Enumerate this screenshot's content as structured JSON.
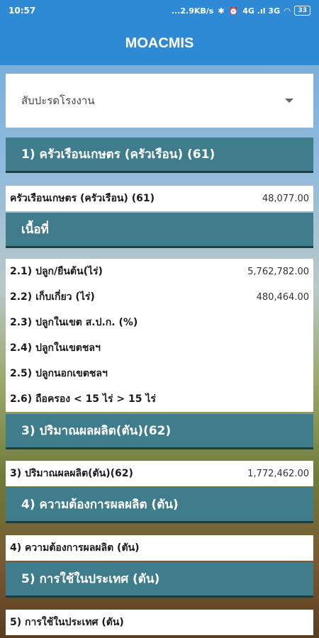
{
  "status": {
    "time": "10:57",
    "speed": "...2.9KB/s",
    "network": "4G .ıl 3G",
    "battery": "33"
  },
  "app": {
    "title": "MOACMIS"
  },
  "dropdown": {
    "value": "สับปะรดโรงงาน"
  },
  "sections": [
    {
      "header": "1) ครัวเรือนเกษตร (ครัวเรือน) (61)",
      "rows": [
        {
          "label": "ครัวเรือนเกษตร (ครัวเรือน) (61)",
          "value": "48,077.00"
        }
      ]
    },
    {
      "header": "เนื้อที่",
      "rows": [
        {
          "label": "2.1) ปลูก/ยืนต้น(ไร่)",
          "value": "5,762,782.00"
        },
        {
          "label": "2.2) เก็บเกี่ยว (ไร่)",
          "value": "480,464.00"
        },
        {
          "label": "2.3) ปลูกในเขต ส.ป.ก. (%)",
          "value": ""
        },
        {
          "label": "2.4) ปลูกในเขตชลฯ",
          "value": ""
        },
        {
          "label": "2.5) ปลูกนอกเขตชลฯ",
          "value": ""
        },
        {
          "label": "2.6) ถือครอง < 15 ไร่ > 15 ไร่",
          "value": ""
        }
      ]
    },
    {
      "header": "3) ปริมาณผลผลิต(ตัน)(62)",
      "rows": [
        {
          "label": "3) ปริมาณผลผลิต(ตัน)(62)",
          "value": "1,772,462.00"
        }
      ]
    },
    {
      "header": "4) ความต้องการผลผลิต (ตัน)",
      "rows": [
        {
          "label": "4) ความต้องการผลผลิต (ตัน)",
          "value": ""
        }
      ]
    },
    {
      "header": "5) การใช้ในประเทศ (ตัน)",
      "rows": [
        {
          "label": "5) การใช้ในประเทศ (ตัน)",
          "value": ""
        }
      ]
    }
  ]
}
